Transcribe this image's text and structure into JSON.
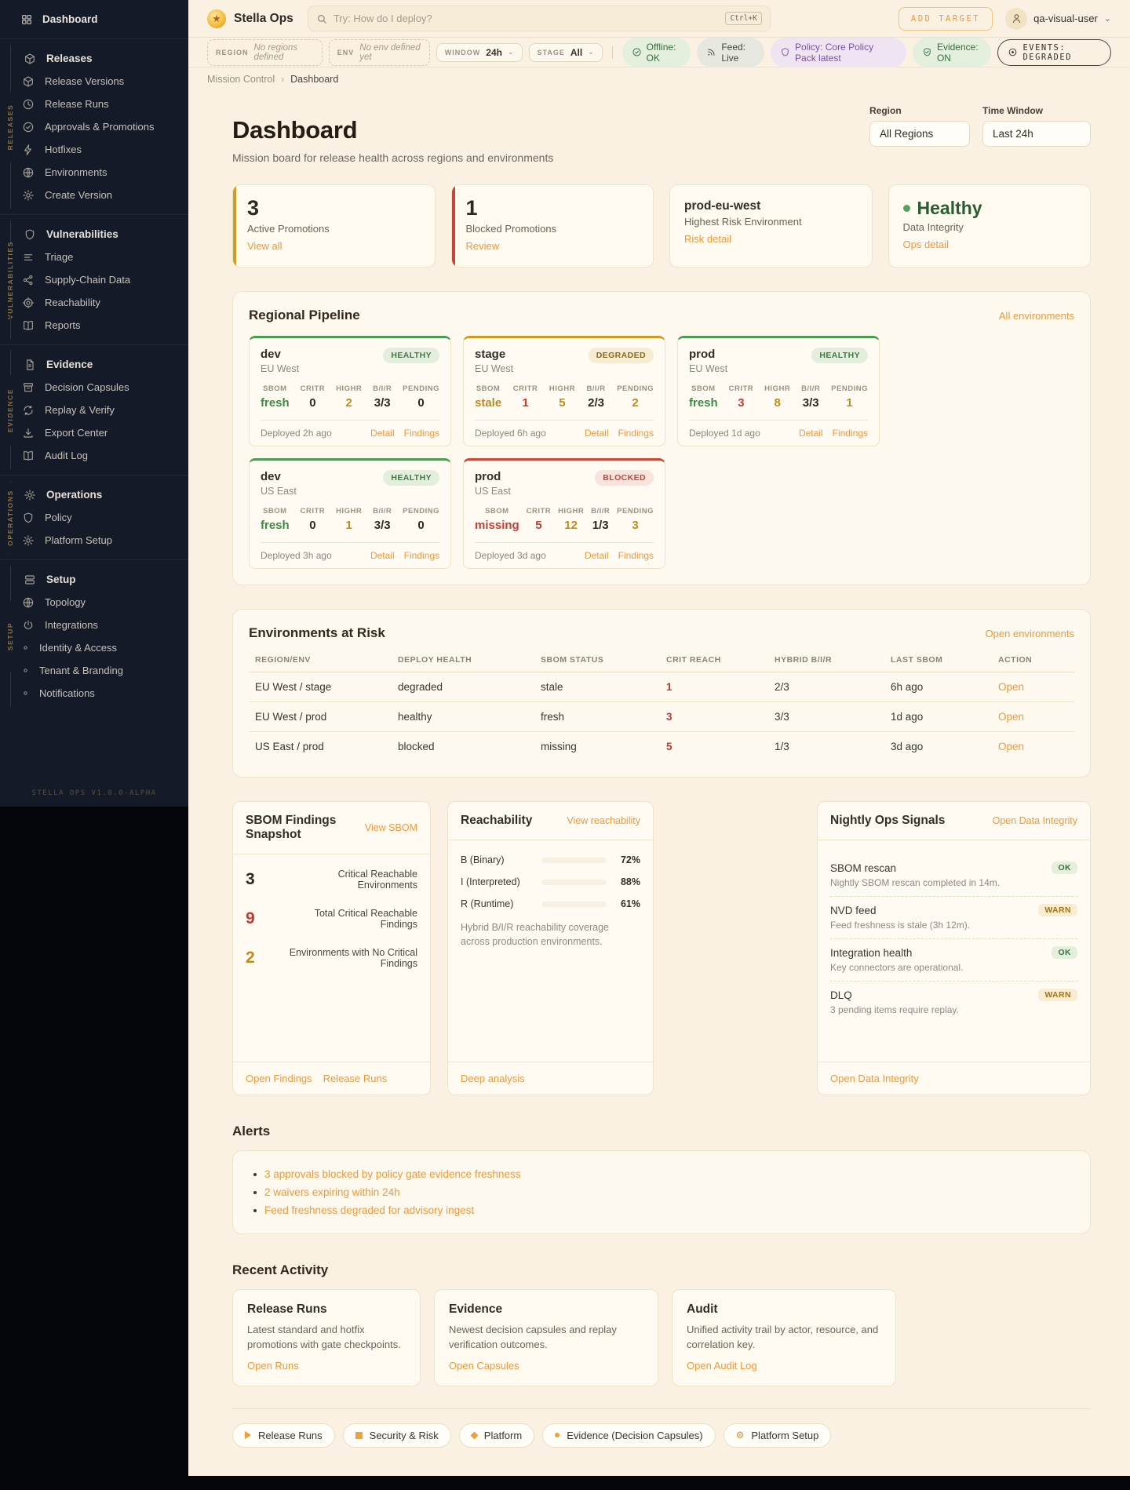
{
  "colors": {
    "accent_orange": "#ec9a3e",
    "green": "#3d8b45",
    "red": "#c43d32",
    "amber": "#bf8a1e",
    "purple": "#7b50a0",
    "sidebar_bg": "#151a28",
    "cream_bg": "#faf1e3"
  },
  "sidebar": {
    "dashboard": "Dashboard",
    "groups": [
      {
        "rail": "RELEASES",
        "items": [
          {
            "icon": "box",
            "label": "Releases",
            "head": true
          },
          {
            "icon": "box",
            "label": "Release Versions"
          },
          {
            "icon": "clock",
            "label": "Release Runs"
          },
          {
            "icon": "check-circle",
            "label": "Approvals & Promotions"
          },
          {
            "icon": "bolt",
            "label": "Hotfixes"
          },
          {
            "icon": "globe",
            "label": "Environments"
          },
          {
            "icon": "gear",
            "label": "Create Version"
          }
        ]
      },
      {
        "rail": "VULNERABILITIES",
        "items": [
          {
            "icon": "shield",
            "label": "Vulnerabilities",
            "head": true
          },
          {
            "icon": "list",
            "label": "Triage"
          },
          {
            "icon": "share",
            "label": "Supply-Chain Data"
          },
          {
            "icon": "target",
            "label": "Reachability"
          },
          {
            "icon": "book",
            "label": "Reports"
          }
        ]
      },
      {
        "rail": "EVIDENCE",
        "items": [
          {
            "icon": "file",
            "label": "Evidence",
            "head": true
          },
          {
            "icon": "archive",
            "label": "Decision Capsules"
          },
          {
            "icon": "refresh",
            "label": "Replay & Verify"
          },
          {
            "icon": "download",
            "label": "Export Center"
          },
          {
            "icon": "book",
            "label": "Audit Log"
          }
        ]
      },
      {
        "rail": "OPERATIONS",
        "items": [
          {
            "icon": "gear",
            "label": "Operations",
            "head": true
          },
          {
            "icon": "shield",
            "label": "Policy"
          },
          {
            "icon": "gear",
            "label": "Platform Setup"
          }
        ]
      },
      {
        "rail": "SETUP",
        "items": [
          {
            "icon": "stack",
            "label": "Setup",
            "head": true
          },
          {
            "icon": "globe",
            "label": "Topology"
          },
          {
            "icon": "power",
            "label": "Integrations"
          },
          {
            "icon": "dot",
            "label": "Identity & Access"
          },
          {
            "icon": "dot",
            "label": "Tenant & Branding"
          },
          {
            "icon": "dot",
            "label": "Notifications"
          }
        ]
      }
    ],
    "version": "STELLA OPS V1.0.0-ALPHA"
  },
  "topbar": {
    "brand": "Stella Ops",
    "search_placeholder": "Try: How do I deploy?",
    "search_kbd": "Ctrl+K",
    "add_target": "ADD TARGET",
    "user": "qa-visual-user"
  },
  "statusbar": {
    "region_label": "REGION",
    "region_value": "No regions defined",
    "env_label": "ENV",
    "env_value": "No env defined yet",
    "window_label": "WINDOW",
    "window_value": "24h",
    "stage_label": "STAGE",
    "stage_value": "All",
    "pills": [
      {
        "icon": "check-circle",
        "text": "Offline: OK",
        "tone": "green"
      },
      {
        "icon": "feed",
        "text": "Feed: Live",
        "tone": "gray"
      },
      {
        "icon": "shield",
        "text": "Policy: Core Policy Pack latest",
        "tone": "purple"
      },
      {
        "icon": "shield-check",
        "text": "Evidence: ON",
        "tone": "green"
      },
      {
        "icon": "events",
        "text": "EVENTS: DEGRADED",
        "tone": "outline"
      }
    ]
  },
  "breadcrumb": {
    "parent": "Mission Control",
    "current": "Dashboard"
  },
  "page": {
    "title": "Dashboard",
    "subtitle": "Mission board for release health across regions and environments"
  },
  "filters": {
    "region_label": "Region",
    "region_value": "All Regions",
    "window_label": "Time Window",
    "window_value": "Last 24h"
  },
  "summary": {
    "cards": [
      {
        "value": "3",
        "label": "Active Promotions",
        "link": "View all"
      },
      {
        "value": "1",
        "label": "Blocked Promotions",
        "link": "Review"
      },
      {
        "title": "prod-eu-west",
        "label": "Highest Risk Environment",
        "link": "Risk detail"
      },
      {
        "value": "Healthy",
        "label": "Data Integrity",
        "link": "Ops detail"
      }
    ]
  },
  "pipeline": {
    "title": "Regional Pipeline",
    "link": "All environments",
    "metric_labels": [
      "SBOM",
      "CRITR",
      "HIGHR",
      "B/I/R",
      "PENDING"
    ],
    "card_links": [
      "Detail",
      "Findings"
    ],
    "cards": [
      {
        "env": "dev",
        "region": "EU West",
        "status": "HEALTHY",
        "tone": "green",
        "deployed": "Deployed 2h ago",
        "metrics": [
          {
            "value": "fresh",
            "tone": "green"
          },
          {
            "value": "0",
            "tone": "dark"
          },
          {
            "value": "2",
            "tone": "amber"
          },
          {
            "value": "3/3",
            "tone": "dark"
          },
          {
            "value": "0",
            "tone": "dark"
          }
        ]
      },
      {
        "env": "stage",
        "region": "EU West",
        "status": "DEGRADED",
        "tone": "amber",
        "deployed": "Deployed 6h ago",
        "metrics": [
          {
            "value": "stale",
            "tone": "amber"
          },
          {
            "value": "1",
            "tone": "red"
          },
          {
            "value": "5",
            "tone": "amber"
          },
          {
            "value": "2/3",
            "tone": "dark"
          },
          {
            "value": "2",
            "tone": "amber"
          }
        ]
      },
      {
        "env": "prod",
        "region": "EU West",
        "status": "HEALTHY",
        "tone": "green",
        "deployed": "Deployed 1d ago",
        "metrics": [
          {
            "value": "fresh",
            "tone": "green"
          },
          {
            "value": "3",
            "tone": "red"
          },
          {
            "value": "8",
            "tone": "amber"
          },
          {
            "value": "3/3",
            "tone": "dark"
          },
          {
            "value": "1",
            "tone": "amber"
          }
        ]
      },
      {
        "env": "dev",
        "region": "US East",
        "status": "HEALTHY",
        "tone": "green",
        "deployed": "Deployed 3h ago",
        "metrics": [
          {
            "value": "fresh",
            "tone": "green"
          },
          {
            "value": "0",
            "tone": "dark"
          },
          {
            "value": "1",
            "tone": "amber"
          },
          {
            "value": "3/3",
            "tone": "dark"
          },
          {
            "value": "0",
            "tone": "dark"
          }
        ]
      },
      {
        "env": "prod",
        "region": "US East",
        "status": "BLOCKED",
        "tone": "red",
        "deployed": "Deployed 3d ago",
        "metrics": [
          {
            "value": "missing",
            "tone": "red"
          },
          {
            "value": "5",
            "tone": "red"
          },
          {
            "value": "12",
            "tone": "amber"
          },
          {
            "value": "1/3",
            "tone": "dark"
          },
          {
            "value": "3",
            "tone": "amber"
          }
        ]
      }
    ]
  },
  "risk": {
    "title": "Environments at Risk",
    "link": "Open environments",
    "headers": [
      "REGION/ENV",
      "DEPLOY HEALTH",
      "SBOM STATUS",
      "CRIT REACH",
      "HYBRID B/I/R",
      "LAST SBOM",
      "ACTION"
    ],
    "rows": [
      {
        "cells": [
          "EU West / stage",
          "degraded",
          "stale",
          "1",
          "2/3",
          "6h ago"
        ],
        "action": "Open"
      },
      {
        "cells": [
          "EU West / prod",
          "healthy",
          "fresh",
          "3",
          "3/3",
          "1d ago"
        ],
        "action": "Open"
      },
      {
        "cells": [
          "US East / prod",
          "blocked",
          "missing",
          "5",
          "1/3",
          "3d ago"
        ],
        "action": "Open"
      }
    ]
  },
  "sbom": {
    "title": "SBOM Findings Snapshot",
    "link": "View SBOM",
    "stats": [
      {
        "value": "3",
        "tone": "dark",
        "label": "Critical Reachable Environments"
      },
      {
        "value": "9",
        "tone": "red",
        "label": "Total Critical Reachable Findings"
      },
      {
        "value": "2",
        "tone": "amber",
        "label": "Environments with No Critical Findings"
      }
    ],
    "footer_links": [
      "Open Findings",
      "Release Runs"
    ]
  },
  "reachability": {
    "title": "Reachability",
    "link": "View reachability",
    "bars": [
      {
        "label": "B (Binary)",
        "pct": 72
      },
      {
        "label": "I (Interpreted)",
        "pct": 88
      },
      {
        "label": "R (Runtime)",
        "pct": 61
      }
    ],
    "caption": "Hybrid B/I/R reachability coverage across production environments.",
    "footer_link": "Deep analysis"
  },
  "signals": {
    "title": "Nightly Ops Signals",
    "link": "Open Data Integrity",
    "rows": [
      {
        "name": "SBOM rescan",
        "badge": "OK",
        "desc": "Nightly SBOM rescan completed in 14m."
      },
      {
        "name": "NVD feed",
        "badge": "WARN",
        "desc": "Feed freshness is stale (3h 12m)."
      },
      {
        "name": "Integration health",
        "badge": "OK",
        "desc": "Key connectors are operational."
      },
      {
        "name": "DLQ",
        "badge": "WARN",
        "desc": "3 pending items require replay."
      }
    ],
    "footer_link": "Open Data Integrity"
  },
  "alerts": {
    "title": "Alerts",
    "items": [
      "3 approvals blocked by policy gate evidence freshness",
      "2 waivers expiring within 24h",
      "Feed freshness degraded for advisory ingest"
    ]
  },
  "recent": {
    "title": "Recent Activity",
    "cards": [
      {
        "title": "Release Runs",
        "desc": "Latest standard and hotfix promotions with gate checkpoints.",
        "link": "Open Runs"
      },
      {
        "title": "Evidence",
        "desc": "Newest decision capsules and replay verification outcomes.",
        "link": "Open Capsules"
      },
      {
        "title": "Audit",
        "desc": "Unified activity trail by actor, resource, and correlation key.",
        "link": "Open Audit Log"
      }
    ]
  },
  "legend": {
    "chips": [
      {
        "shape": "triangle",
        "label": "Release Runs"
      },
      {
        "shape": "square",
        "label": "Security & Risk"
      },
      {
        "shape": "diamond",
        "label": "Platform"
      },
      {
        "shape": "dot",
        "label": "Evidence (Decision Capsules)"
      },
      {
        "shape": "gear",
        "label": "Platform Setup"
      }
    ]
  }
}
